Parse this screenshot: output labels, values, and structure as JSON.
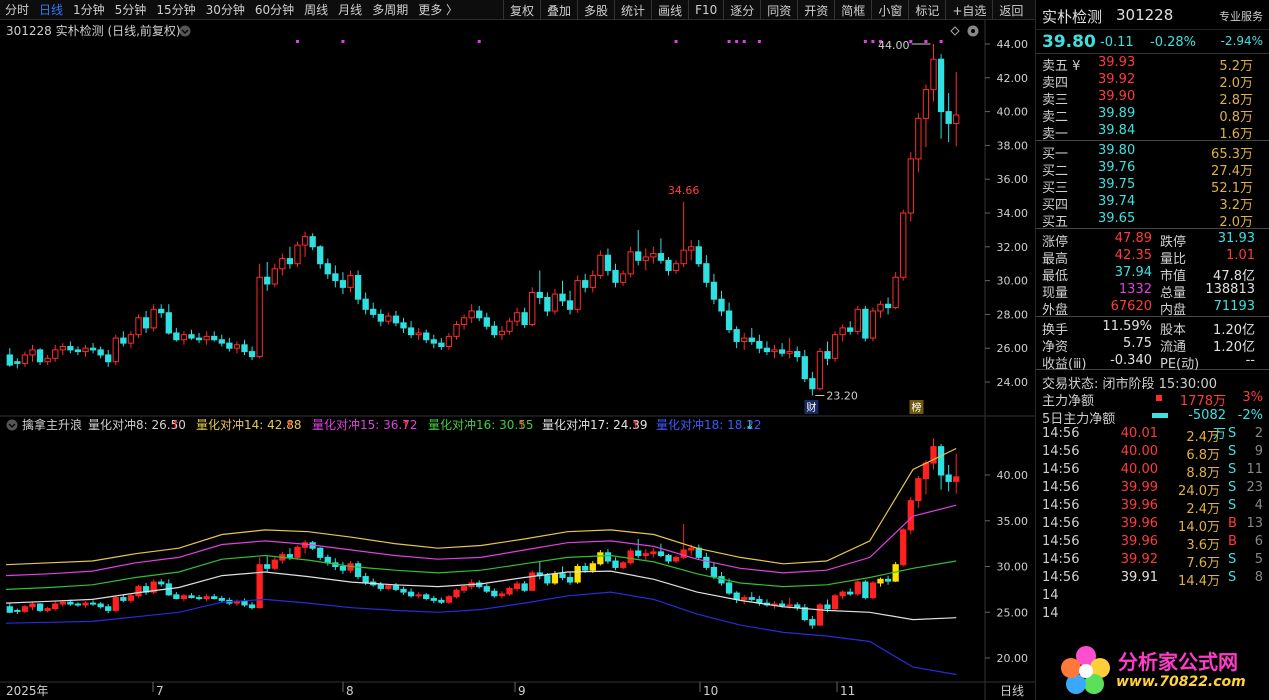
{
  "toolbar": {
    "left_items": [
      "分时",
      "日线",
      "1分钟",
      "5分钟",
      "15分钟",
      "30分钟",
      "60分钟",
      "周线",
      "月线",
      "多周期",
      "更多 〉"
    ],
    "active_index": 1,
    "right_items": [
      "复权",
      "叠加",
      "多股",
      "统计",
      "画线",
      "F10",
      "逐分",
      "同资",
      "开资",
      "简框",
      "小窗",
      "标记",
      "+自选",
      "返回"
    ]
  },
  "chart_header": {
    "title": "301228 实朴检测 (日线,前复权)",
    "dropdown_icon": "chevron-down-icon",
    "diamond_icon": "diamond-icon",
    "settings_icon": "gear-icon"
  },
  "indicator_header": {
    "name": "擒拿主升浪",
    "lines": [
      {
        "label": "量化对冲8: 26.50",
        "color": "#d0d0d0",
        "arrow": "↑"
      },
      {
        "label": "量化对冲14: 42.88",
        "color": "#e6c84a",
        "arrow": "↑"
      },
      {
        "label": "量化对冲15: 36.72",
        "color": "#e040e0",
        "arrow": "↑"
      },
      {
        "label": "量化对冲16: 30.55",
        "color": "#40d040",
        "arrow": "↑"
      },
      {
        "label": "量化对冲17: 24.39",
        "color": "#e0e0e0",
        "arrow": "↑"
      },
      {
        "label": "量化对冲18: 18.22",
        "color": "#3a5cff",
        "arrow": "↓"
      }
    ]
  },
  "main_axis": [
    "44.00",
    "42.00",
    "40.00",
    "38.00",
    "36.00",
    "34.00",
    "32.00",
    "30.00",
    "28.00",
    "26.00",
    "24.00"
  ],
  "sub_axis": [
    "40.00",
    "35.00",
    "30.00",
    "25.00",
    "20.00"
  ],
  "x_axis": [
    "2025年",
    "7",
    "8",
    "9",
    "10",
    "11",
    "日线"
  ],
  "annotations": {
    "high_label": "44.00",
    "peak_label": "34.66",
    "low_label": "23.20",
    "cai_tag": "财",
    "bang_tag": "榜"
  },
  "chart_data": {
    "type": "candlestick",
    "ylim": [
      23,
      45
    ],
    "candles": [
      [
        25.6,
        26.0,
        24.9,
        25.0
      ],
      [
        25.2,
        25.4,
        24.8,
        25.1
      ],
      [
        25.1,
        25.8,
        24.9,
        25.6
      ],
      [
        25.6,
        26.2,
        25.2,
        25.9
      ],
      [
        25.9,
        26.0,
        25.0,
        25.2
      ],
      [
        25.2,
        25.6,
        25.0,
        25.4
      ],
      [
        25.4,
        26.2,
        25.2,
        25.9
      ],
      [
        25.9,
        26.3,
        25.6,
        26.1
      ],
      [
        26.1,
        26.4,
        25.7,
        25.9
      ],
      [
        25.9,
        26.1,
        25.6,
        25.8
      ],
      [
        25.8,
        26.2,
        25.5,
        26.0
      ],
      [
        26.0,
        26.3,
        25.7,
        25.9
      ],
      [
        25.9,
        26.1,
        25.4,
        25.6
      ],
      [
        25.6,
        25.9,
        24.9,
        25.2
      ],
      [
        25.2,
        26.8,
        25.0,
        26.6
      ],
      [
        26.6,
        27.0,
        26.1,
        26.3
      ],
      [
        26.3,
        27.0,
        26.0,
        26.8
      ],
      [
        26.8,
        28.0,
        26.6,
        27.8
      ],
      [
        27.8,
        28.2,
        26.9,
        27.2
      ],
      [
        27.2,
        28.6,
        27.0,
        28.3
      ],
      [
        28.3,
        28.6,
        27.8,
        28.1
      ],
      [
        28.1,
        28.6,
        26.8,
        26.9
      ],
      [
        26.9,
        27.2,
        26.4,
        26.5
      ],
      [
        26.5,
        27.0,
        26.2,
        26.8
      ],
      [
        26.8,
        27.1,
        26.5,
        26.6
      ],
      [
        26.6,
        26.9,
        26.3,
        26.5
      ],
      [
        26.5,
        27.0,
        26.2,
        26.7
      ],
      [
        26.7,
        27.0,
        26.4,
        26.5
      ],
      [
        26.5,
        26.8,
        26.1,
        26.3
      ],
      [
        26.3,
        26.6,
        25.8,
        26.0
      ],
      [
        26.0,
        26.4,
        25.7,
        26.2
      ],
      [
        26.2,
        26.5,
        25.6,
        25.8
      ],
      [
        25.8,
        26.1,
        25.3,
        25.5
      ],
      [
        25.5,
        31.0,
        25.4,
        30.2
      ],
      [
        30.2,
        31.1,
        29.4,
        29.8
      ],
      [
        29.8,
        31.0,
        29.6,
        30.7
      ],
      [
        30.7,
        31.6,
        30.3,
        31.3
      ],
      [
        31.3,
        32.0,
        30.7,
        31.0
      ],
      [
        31.0,
        32.3,
        30.8,
        32.1
      ],
      [
        32.1,
        32.9,
        31.4,
        32.6
      ],
      [
        32.6,
        32.8,
        31.8,
        32.0
      ],
      [
        32.0,
        32.1,
        30.7,
        31.0
      ],
      [
        31.0,
        31.3,
        30.1,
        30.4
      ],
      [
        30.4,
        30.9,
        29.6,
        30.0
      ],
      [
        30.0,
        30.5,
        29.2,
        29.6
      ],
      [
        29.6,
        30.6,
        29.3,
        30.3
      ],
      [
        30.3,
        30.6,
        28.6,
        28.9
      ],
      [
        28.9,
        29.3,
        28.0,
        28.3
      ],
      [
        28.3,
        28.7,
        27.8,
        28.0
      ],
      [
        28.0,
        28.3,
        27.3,
        27.6
      ],
      [
        27.6,
        28.1,
        27.4,
        27.9
      ],
      [
        27.9,
        28.2,
        27.3,
        27.5
      ],
      [
        27.5,
        27.8,
        26.9,
        27.2
      ],
      [
        27.2,
        27.6,
        26.6,
        26.8
      ],
      [
        26.8,
        27.2,
        26.5,
        26.9
      ],
      [
        26.9,
        27.1,
        26.3,
        26.5
      ],
      [
        26.5,
        26.8,
        26.0,
        26.3
      ],
      [
        26.3,
        26.6,
        25.9,
        26.1
      ],
      [
        26.1,
        26.9,
        25.9,
        26.7
      ],
      [
        26.7,
        27.6,
        26.5,
        27.4
      ],
      [
        27.4,
        28.0,
        27.1,
        27.8
      ],
      [
        27.8,
        28.6,
        27.5,
        28.2
      ],
      [
        28.2,
        28.5,
        27.6,
        27.8
      ],
      [
        27.8,
        28.1,
        27.1,
        27.3
      ],
      [
        27.3,
        27.6,
        26.6,
        26.8
      ],
      [
        26.8,
        27.3,
        26.5,
        27.0
      ],
      [
        27.0,
        27.8,
        26.8,
        27.6
      ],
      [
        27.6,
        28.4,
        27.3,
        28.1
      ],
      [
        28.1,
        28.4,
        27.2,
        27.4
      ],
      [
        27.4,
        29.6,
        27.3,
        29.3
      ],
      [
        29.3,
        30.6,
        28.6,
        29.0
      ],
      [
        29.0,
        29.3,
        27.9,
        28.2
      ],
      [
        28.2,
        29.5,
        28.0,
        29.2
      ],
      [
        29.2,
        30.0,
        28.5,
        28.8
      ],
      [
        28.8,
        29.4,
        28.0,
        28.3
      ],
      [
        28.3,
        30.3,
        28.1,
        30.0
      ],
      [
        30.0,
        30.4,
        29.3,
        29.6
      ],
      [
        29.6,
        30.6,
        29.3,
        30.3
      ],
      [
        30.3,
        31.8,
        30.1,
        31.5
      ],
      [
        31.5,
        31.9,
        30.3,
        30.6
      ],
      [
        30.6,
        31.0,
        29.6,
        29.9
      ],
      [
        29.9,
        30.6,
        29.7,
        30.4
      ],
      [
        30.4,
        32.0,
        30.2,
        31.7
      ],
      [
        31.7,
        33.0,
        30.9,
        31.2
      ],
      [
        31.2,
        31.9,
        30.6,
        31.4
      ],
      [
        31.4,
        32.0,
        31.0,
        31.6
      ],
      [
        31.6,
        32.5,
        31.0,
        31.2
      ],
      [
        31.2,
        31.4,
        30.3,
        30.6
      ],
      [
        30.6,
        31.2,
        30.4,
        31.0
      ],
      [
        31.0,
        34.66,
        30.8,
        31.8
      ],
      [
        31.8,
        32.4,
        31.2,
        32.0
      ],
      [
        32.0,
        32.4,
        30.8,
        31.0
      ],
      [
        31.0,
        31.5,
        29.6,
        29.9
      ],
      [
        29.9,
        30.4,
        28.6,
        28.9
      ],
      [
        28.9,
        29.4,
        27.9,
        28.2
      ],
      [
        28.2,
        28.7,
        26.9,
        27.1
      ],
      [
        27.1,
        27.3,
        26.0,
        26.4
      ],
      [
        26.4,
        26.9,
        25.9,
        26.6
      ],
      [
        26.6,
        27.2,
        26.2,
        26.4
      ],
      [
        26.4,
        26.8,
        25.7,
        26.0
      ],
      [
        26.0,
        26.4,
        25.6,
        25.8
      ],
      [
        25.8,
        26.2,
        25.4,
        25.9
      ],
      [
        25.9,
        26.3,
        25.5,
        25.7
      ],
      [
        25.7,
        26.6,
        25.4,
        25.8
      ],
      [
        25.8,
        26.1,
        25.2,
        25.5
      ],
      [
        25.5,
        25.9,
        24.0,
        24.2
      ],
      [
        24.2,
        24.6,
        23.2,
        23.6
      ],
      [
        23.6,
        26.0,
        23.5,
        25.8
      ],
      [
        25.8,
        26.4,
        25.0,
        25.4
      ],
      [
        25.4,
        27.0,
        25.2,
        26.8
      ],
      [
        26.8,
        27.4,
        26.4,
        27.2
      ],
      [
        27.2,
        27.6,
        26.8,
        27.0
      ],
      [
        27.0,
        28.5,
        26.8,
        28.3
      ],
      [
        28.3,
        28.5,
        26.4,
        26.6
      ],
      [
        26.6,
        28.4,
        26.4,
        28.2
      ],
      [
        28.2,
        28.8,
        27.8,
        28.6
      ],
      [
        28.6,
        29.0,
        28.0,
        28.4
      ],
      [
        28.4,
        30.5,
        28.3,
        30.2
      ],
      [
        30.2,
        34.2,
        30.0,
        34.0
      ],
      [
        34.0,
        37.6,
        33.5,
        37.2
      ],
      [
        37.2,
        39.9,
        36.4,
        39.6
      ],
      [
        39.6,
        41.6,
        37.9,
        41.3
      ],
      [
        41.3,
        44.0,
        40.6,
        43.1
      ],
      [
        43.1,
        43.4,
        38.4,
        40.0
      ],
      [
        40.0,
        41.1,
        38.2,
        39.3
      ],
      [
        39.3,
        42.35,
        37.94,
        39.8
      ]
    ],
    "indicator_bands": {
      "upper_yellow": [
        30.2,
        30.4,
        30.6,
        31.4,
        32.0,
        33.5,
        34.0,
        33.8,
        33.2,
        32.5,
        32.0,
        32.3,
        33.0,
        33.8,
        34.0,
        33.5,
        32.0,
        31.0,
        30.3,
        30.6,
        32.8,
        40.6,
        42.9
      ],
      "upper_magenta": [
        29.0,
        29.2,
        29.5,
        30.4,
        31.0,
        32.4,
        32.8,
        32.4,
        31.8,
        31.2,
        30.8,
        31.0,
        31.8,
        32.6,
        32.8,
        32.2,
        30.8,
        29.8,
        29.3,
        29.6,
        31.0,
        35.5,
        36.7
      ],
      "mid_green": [
        27.5,
        27.7,
        28.0,
        28.8,
        29.4,
        30.8,
        31.2,
        30.7,
        30.0,
        29.6,
        29.3,
        29.6,
        30.3,
        31.0,
        31.2,
        30.5,
        29.2,
        28.2,
        27.8,
        28.0,
        28.8,
        29.8,
        30.6
      ],
      "lower_white": [
        26.0,
        26.2,
        26.4,
        27.1,
        27.7,
        29.0,
        29.4,
        28.9,
        28.3,
        28.0,
        27.8,
        28.1,
        28.8,
        29.4,
        29.5,
        28.6,
        27.2,
        26.3,
        25.6,
        25.2,
        25.0,
        24.2,
        24.4
      ],
      "lowest_blue": [
        23.8,
        23.9,
        24.0,
        24.5,
        25.0,
        26.1,
        26.4,
        26.0,
        25.5,
        25.2,
        25.0,
        25.3,
        26.0,
        26.8,
        27.2,
        26.4,
        24.8,
        23.6,
        22.8,
        22.4,
        21.8,
        19.0,
        18.2
      ]
    }
  },
  "right_panel": {
    "name": "实朴检测",
    "code": "301228",
    "service": "专业服务",
    "price": "39.80",
    "change": "-0.11",
    "change_pct": "-0.28%",
    "badge": "-2.94%",
    "asks": [
      {
        "label": "卖五 ¥",
        "price": "39.93",
        "vol": "5.2万"
      },
      {
        "label": "卖四",
        "price": "39.92",
        "vol": "2.0万"
      },
      {
        "label": "卖三",
        "price": "39.90",
        "vol": "2.8万"
      },
      {
        "label": "卖二",
        "price": "39.89",
        "vol": "0.8万"
      },
      {
        "label": "卖一",
        "price": "39.84",
        "vol": "1.6万"
      }
    ],
    "bids": [
      {
        "label": "买一",
        "price": "39.80",
        "vol": "65.3万"
      },
      {
        "label": "买二",
        "price": "39.76",
        "vol": "27.4万"
      },
      {
        "label": "买三",
        "price": "39.75",
        "vol": "52.1万"
      },
      {
        "label": "买四",
        "price": "39.74",
        "vol": "3.2万"
      },
      {
        "label": "买五",
        "price": "39.65",
        "vol": "2.0万"
      }
    ],
    "stats1": [
      {
        "l1": "涨停",
        "v1": "47.89",
        "c1": "red",
        "l2": "跌停",
        "v2": "31.93",
        "c2": "cyan"
      },
      {
        "l1": "最高",
        "v1": "42.35",
        "c1": "red",
        "l2": "量比",
        "v2": "1.01",
        "c2": "red"
      },
      {
        "l1": "最低",
        "v1": "37.94",
        "c1": "cyan",
        "l2": "市值",
        "v2": "47.8亿",
        "c2": "white"
      },
      {
        "l1": "现量",
        "v1": "1332",
        "c1": "magenta",
        "l2": "总量",
        "v2": "138813",
        "c2": "white"
      },
      {
        "l1": "外盘",
        "v1": "67620",
        "c1": "red",
        "l2": "内盘",
        "v2": "71193",
        "c2": "cyan"
      }
    ],
    "stats2": [
      {
        "l1": "换手",
        "v1": "11.59%",
        "c1": "white",
        "l2": "股本",
        "v2": "1.20亿",
        "c2": "white"
      },
      {
        "l1": "净资",
        "v1": "5.75",
        "c1": "white",
        "l2": "流通",
        "v2": "1.20亿",
        "c2": "white"
      },
      {
        "l1": "收益(ⅲ)",
        "v1": "-0.340",
        "c1": "white",
        "l2": "PE(动)",
        "v2": "--",
        "c2": "white"
      }
    ],
    "status": "交易状态: 闭市阶段 15:30:00",
    "flow": [
      {
        "label": "主力净额",
        "val": "1778万",
        "pct": "3%",
        "color": "red"
      },
      {
        "label": "5日主力净额",
        "val": "-5082万",
        "pct": "-2%",
        "color": "cyan"
      }
    ],
    "ticks": [
      {
        "time": "14:56",
        "price": "40.01",
        "vol": "2.4万",
        "side": "S",
        "num": "2",
        "pc": "red"
      },
      {
        "time": "14:56",
        "price": "40.00",
        "vol": "6.8万",
        "side": "S",
        "num": "9",
        "pc": "red"
      },
      {
        "time": "14:56",
        "price": "40.00",
        "vol": "8.8万",
        "side": "S",
        "num": "11",
        "pc": "red"
      },
      {
        "time": "14:56",
        "price": "39.99",
        "vol": "24.0万",
        "side": "S",
        "num": "23",
        "pc": "red"
      },
      {
        "time": "14:56",
        "price": "39.96",
        "vol": "2.4万",
        "side": "S",
        "num": "4",
        "pc": "red"
      },
      {
        "time": "14:56",
        "price": "39.96",
        "vol": "14.0万",
        "side": "B",
        "num": "13",
        "pc": "red"
      },
      {
        "time": "14:56",
        "price": "39.96",
        "vol": "3.6万",
        "side": "B",
        "num": "6",
        "pc": "red"
      },
      {
        "time": "14:56",
        "price": "39.92",
        "vol": "7.6万",
        "side": "S",
        "num": "5",
        "pc": "red"
      },
      {
        "time": "14:56",
        "price": "39.91",
        "vol": "14.4万",
        "side": "S",
        "num": "8",
        "pc": "white"
      },
      {
        "time": "14",
        "price": "",
        "vol": "",
        "side": "",
        "num": "",
        "pc": "white"
      },
      {
        "time": "14",
        "price": "",
        "vol": "",
        "side": "",
        "num": "",
        "pc": "white"
      }
    ]
  },
  "watermark": {
    "name": "分析家公式网",
    "url": "www.70822.com"
  }
}
